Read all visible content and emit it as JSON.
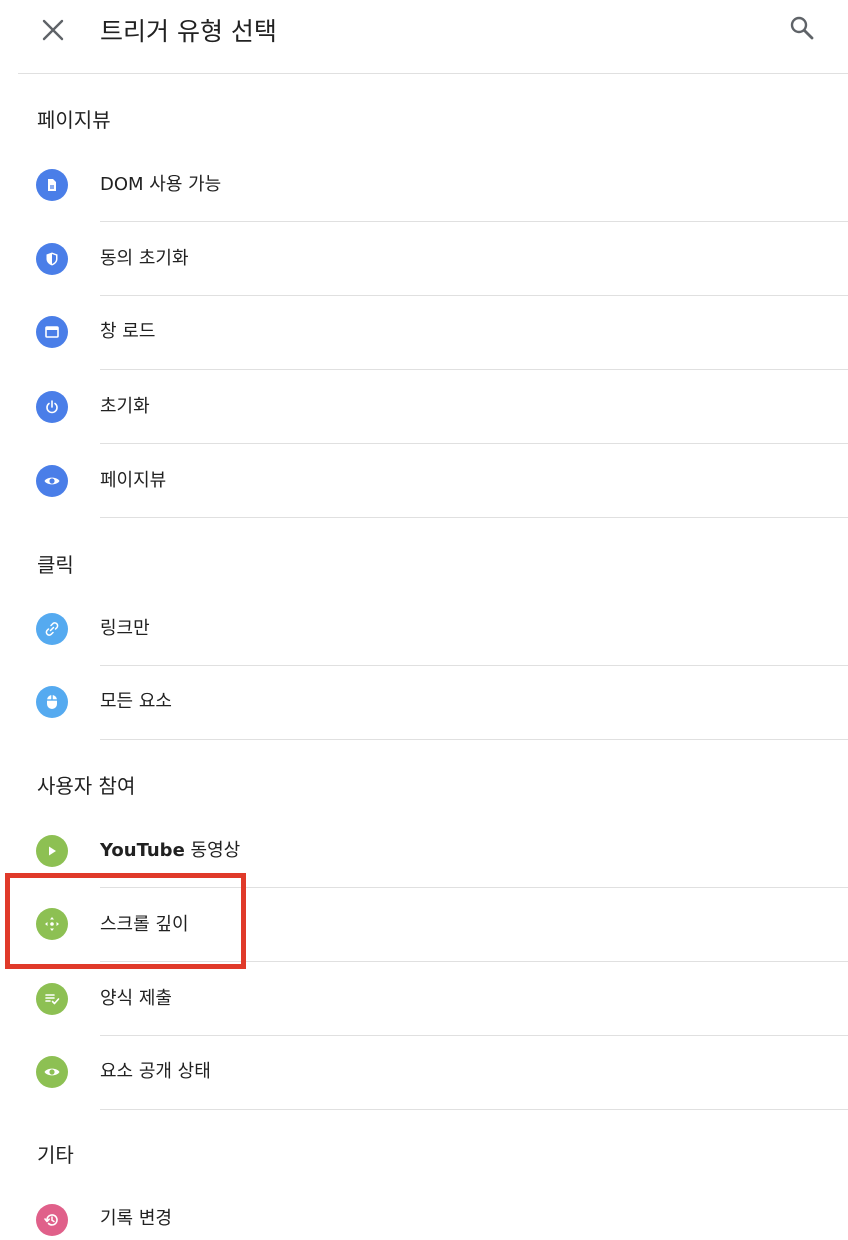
{
  "header": {
    "title": "트리거 유형 선택"
  },
  "sections": [
    {
      "title": "페이지뷰",
      "items": [
        {
          "label": "DOM 사용 가능",
          "icon": "document-icon",
          "color": "#4a7ee8"
        },
        {
          "label": "동의 초기화",
          "icon": "shield-icon",
          "color": "#4a7ee8"
        },
        {
          "label": "창 로드",
          "icon": "window-icon",
          "color": "#4a7ee8"
        },
        {
          "label": "초기화",
          "icon": "power-icon",
          "color": "#4a7ee8"
        },
        {
          "label": "페이지뷰",
          "icon": "eye-icon",
          "color": "#4a7ee8"
        }
      ]
    },
    {
      "title": "클릭",
      "items": [
        {
          "label": "링크만",
          "icon": "link-icon",
          "color": "#55aaf0"
        },
        {
          "label": "모든 요소",
          "icon": "mouse-icon",
          "color": "#55aaf0"
        }
      ]
    },
    {
      "title": "사용자 참여",
      "items": [
        {
          "label_bold": "YouTube",
          "label": " 동영상",
          "icon": "play-icon",
          "color": "#8dc053"
        },
        {
          "label": "스크롤 깊이",
          "icon": "move-icon",
          "color": "#8dc053"
        },
        {
          "label": "양식 제출",
          "icon": "form-check-icon",
          "color": "#8dc053"
        },
        {
          "label": "요소 공개 상태",
          "icon": "eye-icon",
          "color": "#8dc053"
        }
      ]
    },
    {
      "title": "기타",
      "items": [
        {
          "label": "기록 변경",
          "icon": "history-icon",
          "color": "#e0608a"
        }
      ]
    }
  ]
}
